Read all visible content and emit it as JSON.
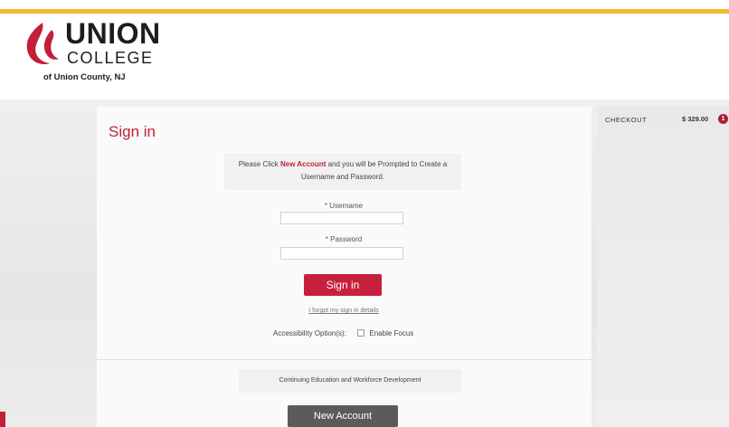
{
  "brand": {
    "line1": "UNION",
    "line2": "COLLEGE",
    "line3": "of Union County, NJ",
    "colors": {
      "accent": "#c21f3a",
      "top_bar": "#f2b632",
      "dark_button": "#5b5b5b"
    }
  },
  "signin": {
    "title": "Sign in",
    "info_prefix": "Please Click ",
    "info_link": "New Account",
    "info_suffix": " and you will be Prompted to Create a Username and Password.",
    "username_label": "Username",
    "password_label": "Password",
    "required_marker": "*",
    "username_value": "",
    "password_value": "",
    "signin_button": "Sign in",
    "forgot_link": "I forgot my sign in details",
    "accessibility_label": "Accessibility Option(s):",
    "enable_focus_label": "Enable Focus",
    "enable_focus_checked": false
  },
  "ce": {
    "heading": "Continuing Education and Workforce Development",
    "new_account_button": "New Account"
  },
  "cart": {
    "label": "CHECKOUT",
    "amount": "$ 329.00",
    "count": "1"
  }
}
